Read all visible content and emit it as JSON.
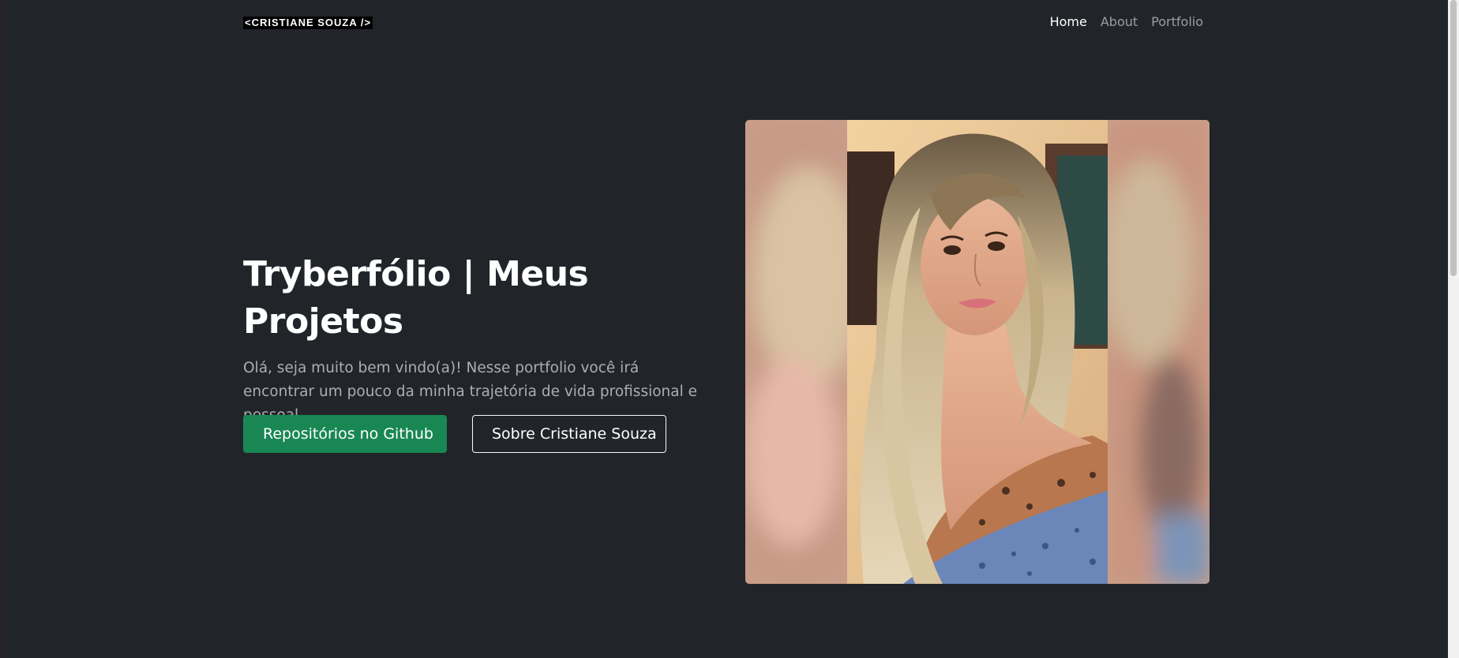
{
  "navbar": {
    "brand": "<CRISTIANE SOUZA />",
    "links": [
      {
        "label": "Home",
        "active": true
      },
      {
        "label": "About",
        "active": false
      },
      {
        "label": "Portfolio",
        "active": false
      }
    ]
  },
  "hero": {
    "title": "Tryberfólio | Meus Projetos",
    "lead": "Olá, seja muito bem vindo(a)! Nesse portfolio você irá encontrar um pouco da minha trajetória de vida profissional e pessoal.",
    "primary_button": "Repositórios no Github",
    "secondary_button": "Sobre Cristiane Souza"
  },
  "colors": {
    "background": "#212529",
    "success": "#198754",
    "text_muted": "#adb5bd"
  },
  "icons": {
    "photo": "profile-photo"
  }
}
